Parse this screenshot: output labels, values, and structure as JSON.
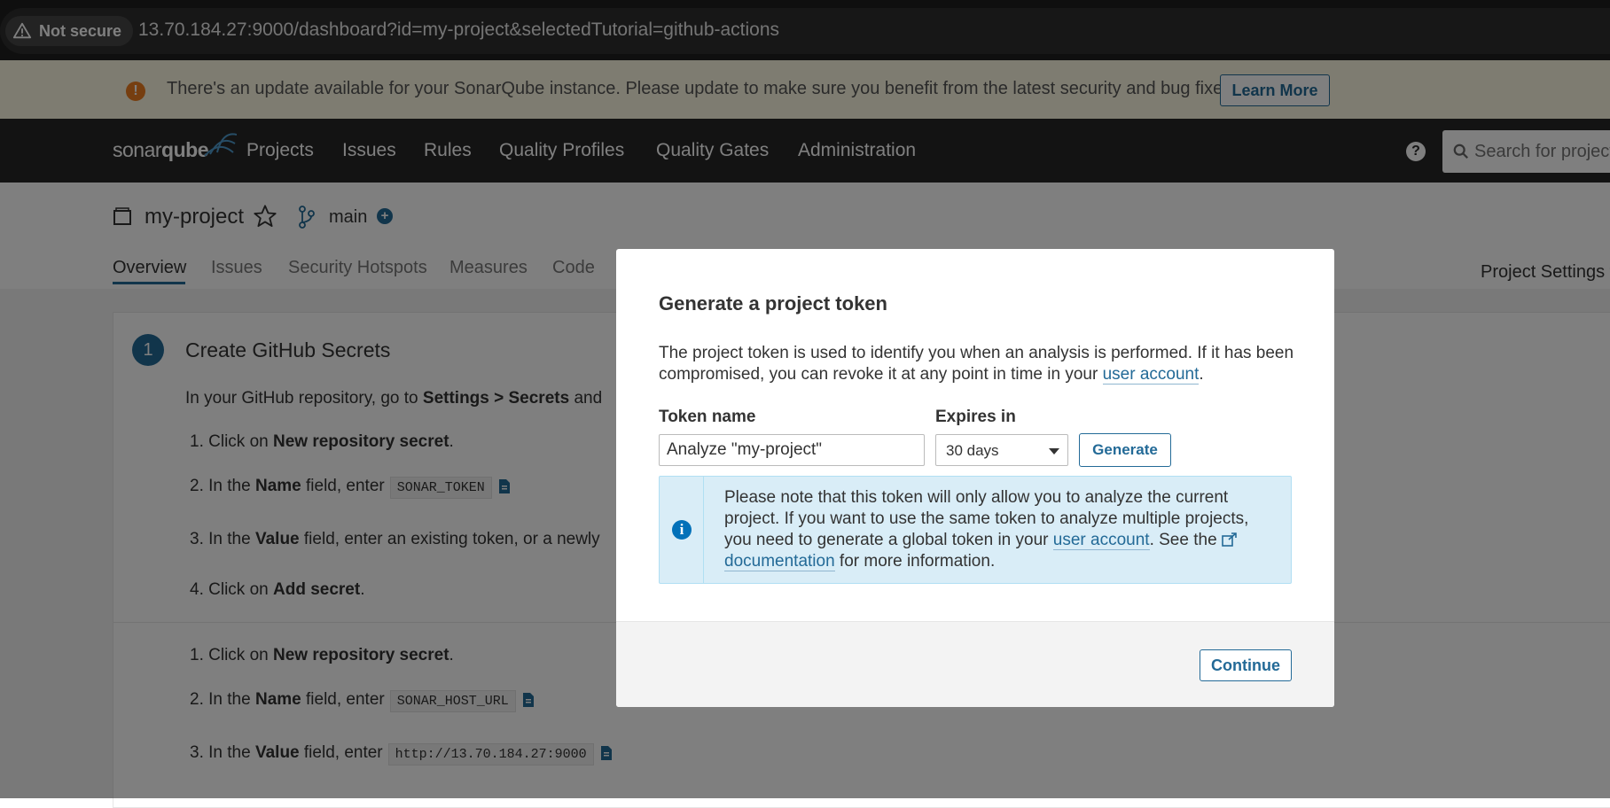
{
  "browser": {
    "security_label": "Not secure",
    "url": "13.70.184.27:9000/dashboard?id=my-project&selectedTutorial=github-actions"
  },
  "update_banner": {
    "message": "There's an update available for your SonarQube instance. Please update to make sure you benefit from the latest security and bug fixes.",
    "learn_more_label": "Learn More"
  },
  "navbar": {
    "logo_light": "sonar",
    "logo_bold": "qube",
    "items": [
      "Projects",
      "Issues",
      "Rules",
      "Quality Profiles",
      "Quality Gates",
      "Administration"
    ],
    "search_placeholder": "Search for projects..."
  },
  "project": {
    "name": "my-project",
    "branch": "main",
    "tabs": [
      "Overview",
      "Issues",
      "Security Hotspots",
      "Measures",
      "Code"
    ],
    "settings_label": "Project Settings"
  },
  "tutorial": {
    "step_number": "1",
    "step_title": "Create GitHub Secrets",
    "intro_prefix": "In your GitHub repository, go to ",
    "intro_bold": "Settings > Secrets",
    "intro_suffix": " and",
    "lines": [
      {
        "num": "1.",
        "pre": "Click on ",
        "bold": "New repository secret",
        "post": "."
      },
      {
        "num": "2.",
        "pre": "In the ",
        "bold": "Name",
        "post": " field, enter",
        "code": "SONAR_TOKEN"
      },
      {
        "num": "3.",
        "pre": "In the ",
        "bold": "Value",
        "post": " field, enter an existing token, or a newly"
      },
      {
        "num": "4.",
        "pre": "Click on ",
        "bold": "Add secret",
        "post": "."
      },
      {
        "num": "1.",
        "pre": "Click on ",
        "bold": "New repository secret",
        "post": "."
      },
      {
        "num": "2.",
        "pre": "In the ",
        "bold": "Name",
        "post": " field, enter",
        "code": "SONAR_HOST_URL"
      },
      {
        "num": "3.",
        "pre": "In the ",
        "bold": "Value",
        "post": " field, enter",
        "code": "http://13.70.184.27:9000"
      }
    ]
  },
  "modal": {
    "title": "Generate a project token",
    "desc_prefix": "The project token is used to identify you when an analysis is performed. If it has been compromised, you can revoke it at any point in time in your ",
    "desc_link": "user account",
    "desc_suffix": ".",
    "token_name_label": "Token name",
    "token_name_value": "Analyze \"my-project\"",
    "expires_label": "Expires in",
    "expires_value": "30 days",
    "generate_label": "Generate",
    "info_prefix": "Please note that this token will only allow you to analyze the current project. If you want to use the same token to analyze multiple projects, you need to generate a global token in your ",
    "info_link1": "user account",
    "info_mid": ". See the ",
    "info_link2": "documentation",
    "info_suffix": " for more information.",
    "continue_label": "Continue"
  },
  "colors": {
    "accent": "#236a97",
    "navbar_bg": "#262626",
    "banner_bg": "#fcf8e3",
    "info_bg": "#d9edf7"
  }
}
